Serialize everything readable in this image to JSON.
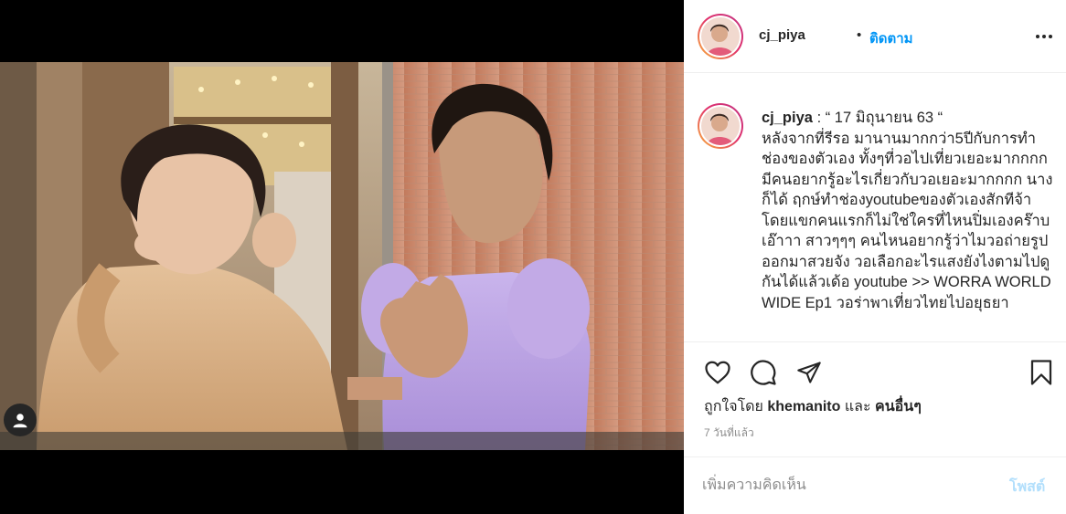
{
  "post": {
    "username": "cj_piya",
    "follow_separator": "•",
    "follow_label": "ติดตาม",
    "more_icon": "more-horizontal-icon",
    "caption": ": “ 17 มิถุนายน 63 “\nหลังจากที่รีรอ มานานมากกว่า5ปีกับการทำช่องของตัวเอง ทั้งๆที่วอไปเที่ยวเยอะมากกกก มีคนอยากรู้อะไรเกี่ยวกับวอเยอะมากกกก นางก็ได้ ฤกษ์ทำช่องyoutubeของตัวเองสักทีจ้า โดยแขกคนแรกก็ไม่ใช่ใครที่ไหนปิ่มเองคร๊าบ เอ๊าาา สาวๆๆๆ คนไหนอยากรู้ว่าไมวอถ่ายรูปออกมาสวยจัง วอเลือกอะไรแสงยังไงตามไปดูกันได้แล้วเด้อ youtube >> WORRA WORLD WIDE Ep1 วอร่าพาเที่ยวไทยไปอยุธยา",
    "likes_prefix": "ถูกใจโดย",
    "likes_user": "khemanito",
    "likes_and": "และ",
    "likes_others": "คนอื่นๆ",
    "timestamp": "7 วันที่แล้ว",
    "comment_placeholder": "เพิ่มความคิดเห็น",
    "post_label": "โพสต์"
  },
  "icons": {
    "like": "heart-icon",
    "comment": "comment-icon",
    "share": "paper-plane-icon",
    "save": "bookmark-icon",
    "tag": "user-tag-icon"
  },
  "colors": {
    "link_blue": "#0095f6",
    "post_disabled": "#b2dffc",
    "text": "#262626",
    "muted": "#8e8e8e"
  }
}
